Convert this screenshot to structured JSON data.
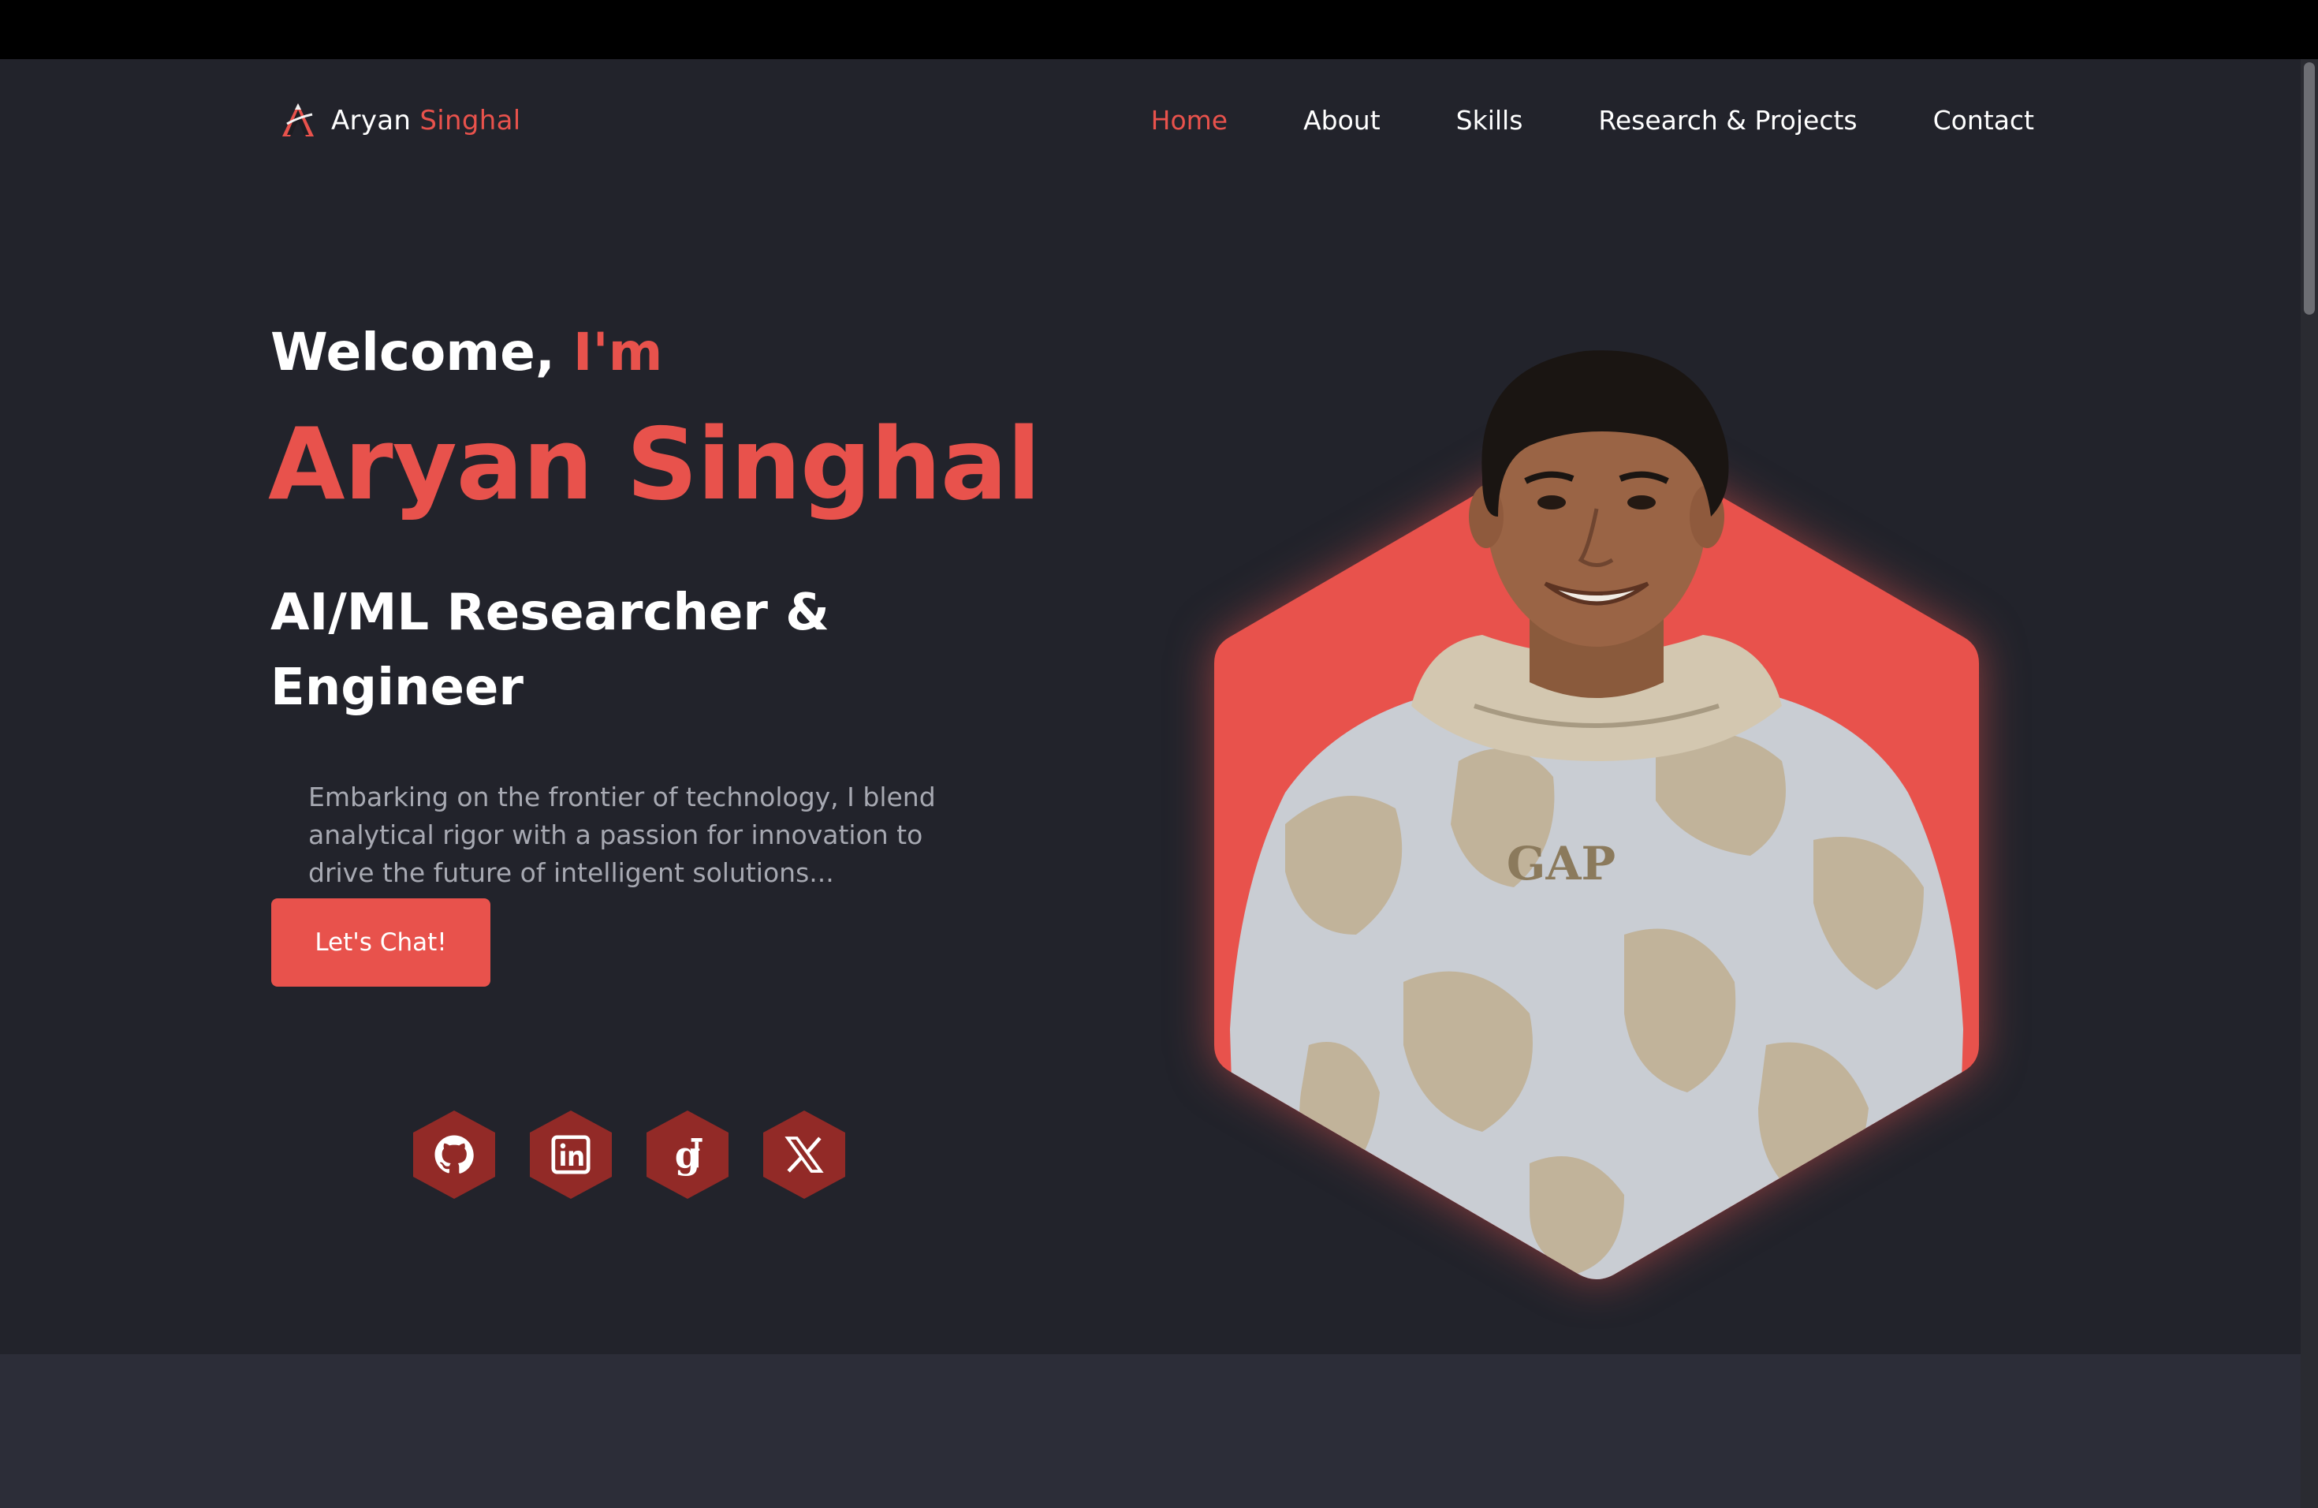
{
  "brand": {
    "first": "Aryan",
    "last": "Singhal",
    "logo_icon": "a-letter-logo-icon"
  },
  "nav": {
    "items": [
      {
        "label": "Home",
        "active": true
      },
      {
        "label": "About",
        "active": false
      },
      {
        "label": "Skills",
        "active": false
      },
      {
        "label": "Research & Projects",
        "active": false
      },
      {
        "label": "Contact",
        "active": false
      }
    ]
  },
  "hero": {
    "welcome": "Welcome,",
    "welcome_accent": "I'm",
    "name": "Aryan Singhal",
    "role": "AI/ML Researcher & Engineer",
    "description": "Embarking on the frontier of technology, I blend analytical rigor with a passion for innovation to drive the future of intelligent solutions...",
    "cta_label": "Let's Chat!",
    "shirt_text": "GAP"
  },
  "socials": [
    {
      "icon": "github-icon"
    },
    {
      "icon": "linkedin-icon"
    },
    {
      "icon": "google-scholar-icon"
    },
    {
      "icon": "x-twitter-icon"
    }
  ],
  "colors": {
    "accent": "#e8524c",
    "background": "#22232b",
    "section_alt": "#2c2d38",
    "social_bg": "#922a27",
    "text_muted": "#a7a9b2"
  }
}
